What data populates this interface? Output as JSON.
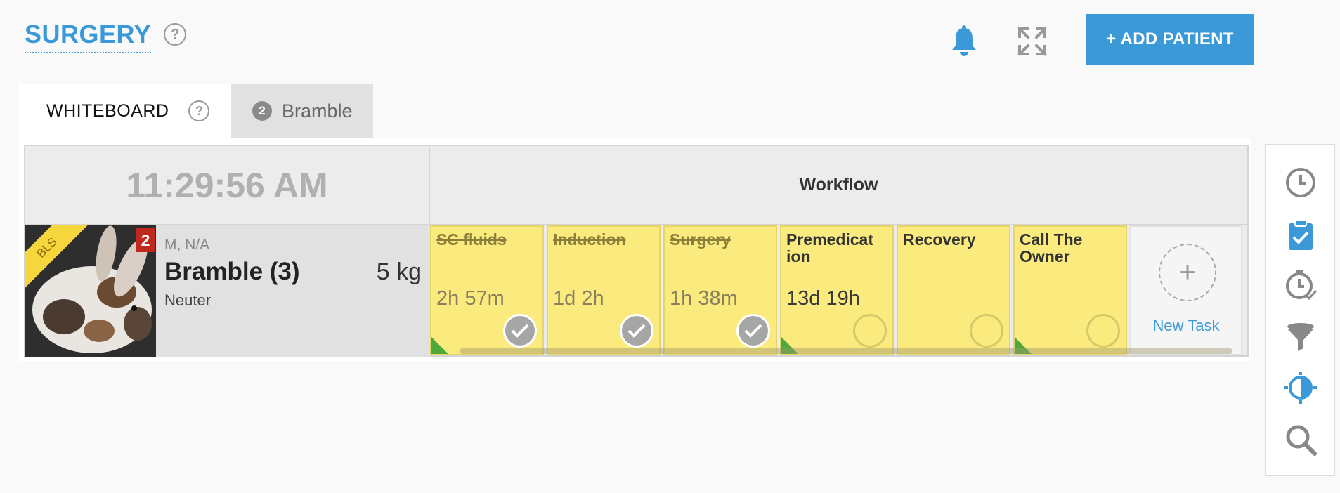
{
  "header": {
    "title": "SURGERY",
    "help": "?",
    "add_patient_label": "+ ADD PATIENT"
  },
  "tabs": [
    {
      "label": "WHITEBOARD",
      "help": "?"
    },
    {
      "label": "Bramble",
      "badge": "2"
    }
  ],
  "board": {
    "clock": "11:29:56 AM",
    "workflow_header": "Workflow",
    "patient": {
      "tag": "BLS",
      "badge": "2",
      "sex_age": "M, N/A",
      "name": "Bramble (3)",
      "weight": "5 kg",
      "note": "Neuter"
    },
    "tasks": [
      {
        "name": "SC fluids",
        "time": "2h 57m",
        "done": true,
        "corner": true
      },
      {
        "name": "Induction",
        "time": "1d 2h",
        "done": true,
        "corner": false
      },
      {
        "name": "Surgery",
        "time": "1h 38m",
        "done": true,
        "corner": false
      },
      {
        "name": "Premedicat ion",
        "time": "13d 19h",
        "done": false,
        "corner": true
      },
      {
        "name": "Recovery",
        "time": "",
        "done": false,
        "corner": false
      },
      {
        "name": "Call The Owner",
        "time": "",
        "done": false,
        "corner": true
      }
    ],
    "new_task_label": "New Task"
  },
  "side_panel": {
    "icons": [
      "clock-icon",
      "clipboard-check-icon",
      "clock-check-icon",
      "filter-icon",
      "contrast-icon",
      "search-icon"
    ]
  },
  "colors": {
    "accent": "#3b99d8",
    "task_yellow": "#fbeb7e",
    "badge_red": "#c0271d",
    "corner_green": "#4fa83a"
  }
}
